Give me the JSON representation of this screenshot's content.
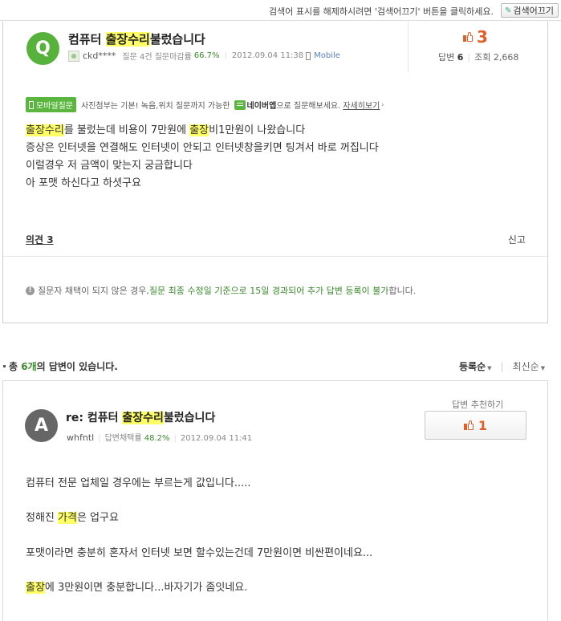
{
  "topbar": {
    "message": "검색어 표시를 해제하시려면 '검색어끄기' 버튼을 클릭하세요.",
    "button_label": "검색어끄기"
  },
  "question": {
    "badge": "Q",
    "title_before": "컴퓨터 ",
    "title_highlight": "출장수리",
    "title_after": "불렀습니다",
    "user": "ckd****",
    "meta_text": "질문 4건 질문마감률",
    "close_rate": "66.7%",
    "date": "2012.09.04 11:38",
    "via": "Mobile",
    "likes": "3",
    "answers_label": "답변",
    "answers": "6",
    "views_label": "조회",
    "views": "2,668",
    "mobile_tag": "모바일질문",
    "mobile_info": "사진첨부는 기본! 녹음,위치 질문까지 가능한",
    "naver_app": "네이버앱",
    "mobile_info2": "으로 질문해보세요.",
    "details_link": "자세히보기",
    "body": [
      {
        "hl1": "출장수리",
        "t1": "를 불렀는데 비용이 7만원에 ",
        "hl2": "출장",
        "t2": "비1만원이 나왔습니다"
      },
      {
        "t1": "증상은 인터넷을 연결해도 인터넷이 안되고 인터넷창을키면 팅겨서 바로 꺼집니다"
      },
      {
        "t1": "이럴경우 저 금액이 맞는지 궁금합니다"
      },
      {
        "t1": "아 포맷 하신다고 하셧구요"
      }
    ],
    "opinion": "의견 3",
    "report": "신고",
    "notice_a": "질문자 채택이 되지 않은 경우, ",
    "notice_b": "질문 최종 수정일 기준으로 15일 경과되어 추가 답변 등록이 불가",
    "notice_c": "합니다."
  },
  "answers_header": {
    "prefix": "총 ",
    "count": "6개",
    "suffix": "의 답변이 있습니다.",
    "sort_active": "등록순",
    "sort_other": "최신순"
  },
  "answer": {
    "badge": "A",
    "title_before": "re: 컴퓨터 ",
    "title_highlight": "출장수리",
    "title_after": "불렀습니다",
    "user": "whfntl",
    "meta_text": "답변채택률",
    "adopt_rate": "48.2%",
    "date": "2012.09.04 11:41",
    "recommend_label": "답변 추천하기",
    "recommend_count": "1",
    "body": [
      {
        "t1": "컴퓨터 전문 업체일 경우에는 부르는게 값입니다....."
      },
      {
        "t1": "정해진 ",
        "hl": "가격",
        "t2": "은 업구요"
      },
      {
        "t1": "포맷이라면 충분히 혼자서 인터넷 보면 할수있는건데 7만원이면 비싼편이네요..."
      },
      {
        "hl": "출장",
        "t2": "에 3만원이면 충분합니다...바자기가 좀잇네요."
      }
    ]
  }
}
